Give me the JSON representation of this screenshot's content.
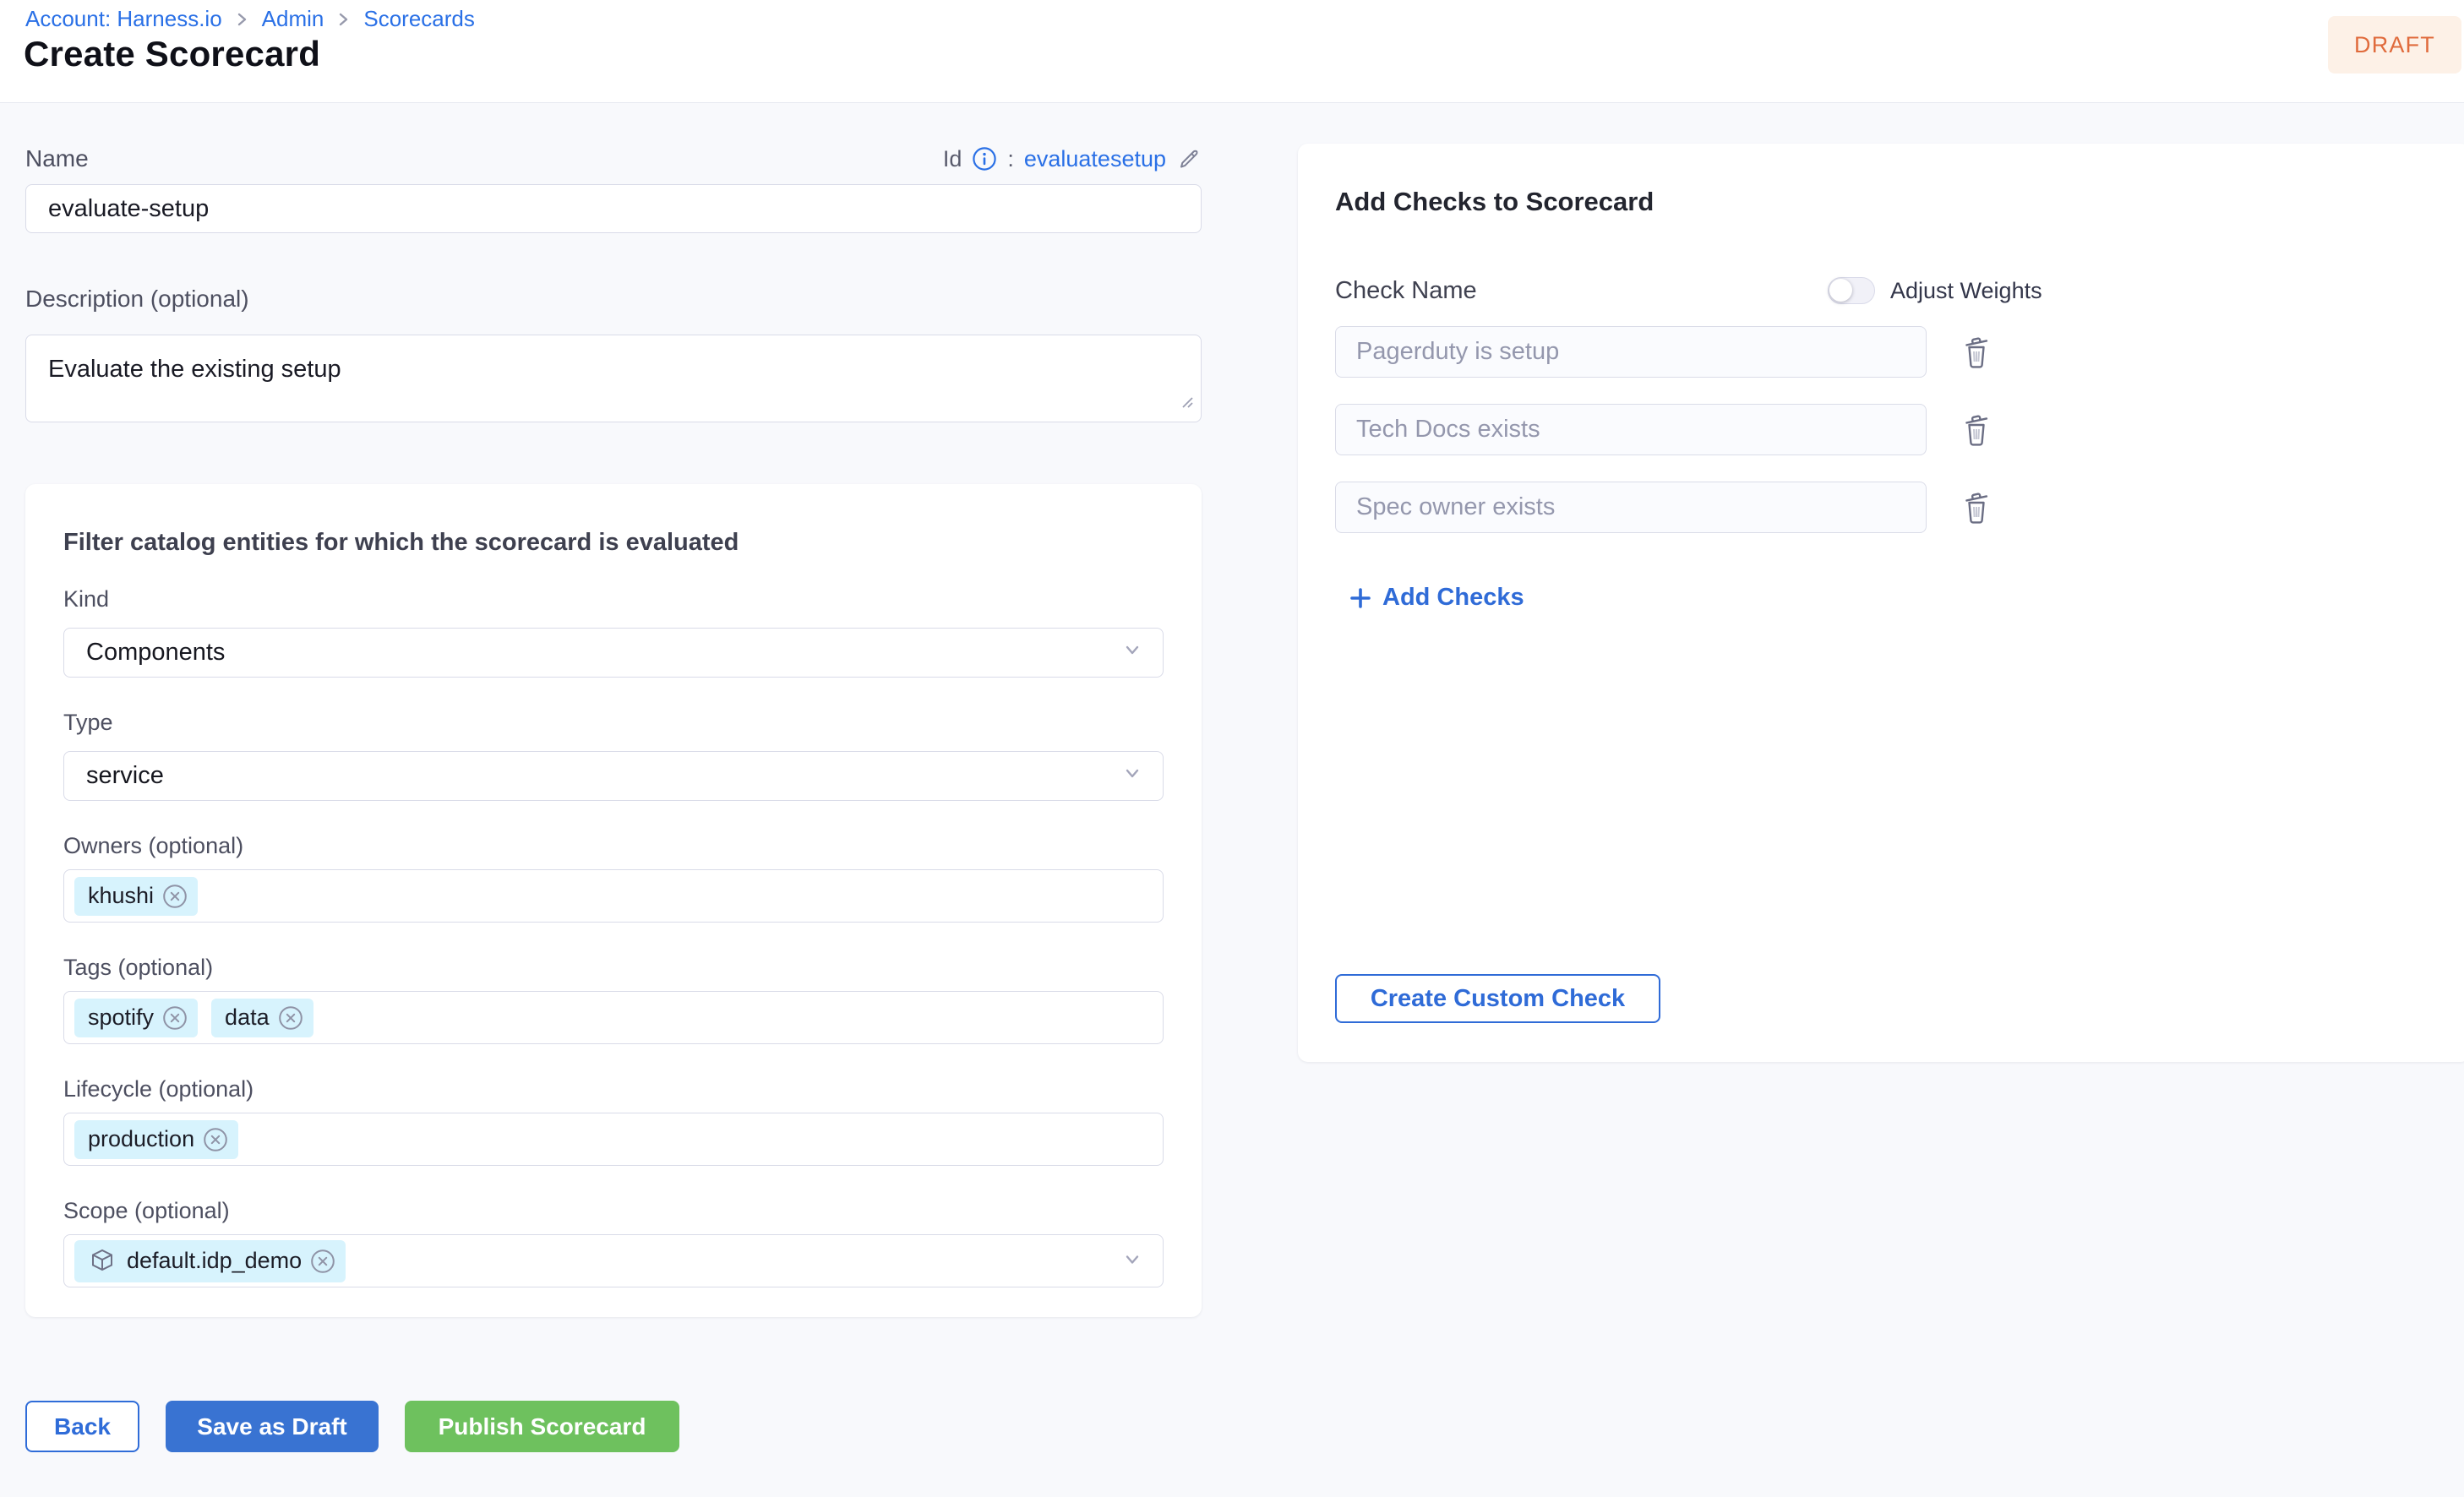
{
  "header": {
    "breadcrumb": [
      "Account: Harness.io",
      "Admin",
      "Scorecards"
    ],
    "title": "Create Scorecard",
    "status_badge": "DRAFT"
  },
  "form": {
    "name": {
      "label": "Name",
      "value": "evaluate-setup"
    },
    "id_row": {
      "label": "Id",
      "separator": ":",
      "value": "evaluatesetup"
    },
    "description": {
      "label": "Description (optional)",
      "value": "Evaluate the existing setup"
    },
    "filter": {
      "title": "Filter catalog entities for which the scorecard is evaluated",
      "kind": {
        "label": "Kind",
        "value": "Components"
      },
      "type": {
        "label": "Type",
        "value": "service"
      },
      "owners": {
        "label": "Owners (optional)",
        "chips": [
          "khushi"
        ]
      },
      "tags": {
        "label": "Tags (optional)",
        "chips": [
          "spotify",
          "data"
        ]
      },
      "lifecycle": {
        "label": "Lifecycle (optional)",
        "chips": [
          "production"
        ]
      },
      "scope": {
        "label": "Scope (optional)",
        "chips": [
          "default.idp_demo"
        ]
      }
    }
  },
  "checks_panel": {
    "title": "Add Checks to Scorecard",
    "column_label": "Check Name",
    "adjust_weights_label": "Adjust Weights",
    "adjust_weights_on": false,
    "checks": [
      "Pagerduty is setup",
      "Tech Docs exists",
      "Spec owner exists"
    ],
    "add_checks_label": "Add Checks",
    "create_custom_check_label": "Create Custom Check"
  },
  "footer_actions": {
    "back": "Back",
    "save_draft": "Save as Draft",
    "publish": "Publish Scorecard"
  },
  "colors": {
    "link_blue": "#2a70e6",
    "action_blue": "#2f6bd7",
    "save_button_blue": "#3973d2",
    "publish_green": "#6ec15e",
    "draft_text": "#e06b3c",
    "draft_bg": "#fdf1e7",
    "chip_bg": "#d7f3fd",
    "page_bg": "#f8f9fc"
  }
}
